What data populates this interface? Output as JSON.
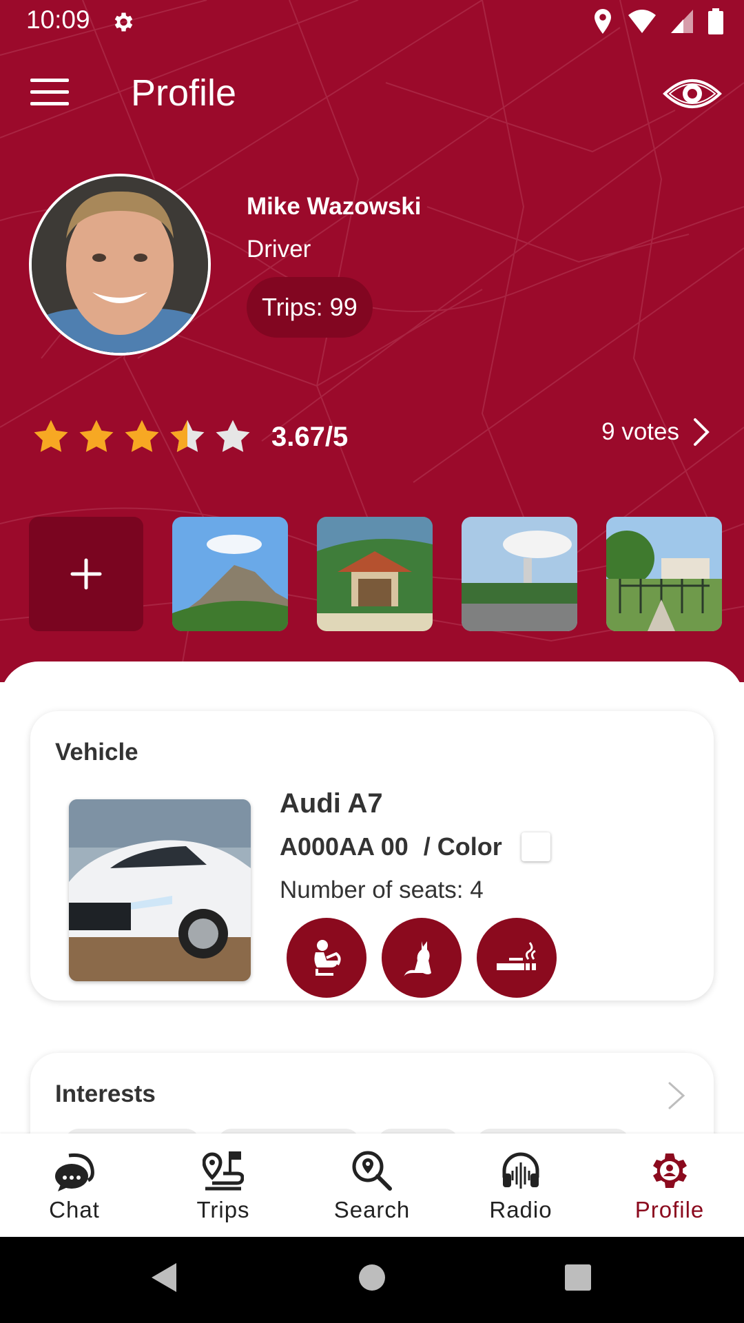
{
  "status_bar": {
    "time": "10:09",
    "icons": [
      "settings-icon",
      "location-icon",
      "wifi-icon",
      "signal-icon",
      "battery-icon"
    ]
  },
  "appbar": {
    "title": "Profile"
  },
  "profile": {
    "name": "Mike Wazowski",
    "role": "Driver",
    "trips": "Trips: 99"
  },
  "rating": {
    "value_text": "3.67/5",
    "value": 3.67,
    "max": 5,
    "votes": "9 votes"
  },
  "photos": [
    "mountain-photo",
    "gazebo-photo",
    "monument-photo",
    "park-gate-photo"
  ],
  "vehicle": {
    "title": "Vehicle",
    "model": "Audi A7",
    "plate": "A000AA 00",
    "color_label": "/ Color",
    "color": "#ffffff",
    "seats": "Number of seats: 4",
    "features": [
      "child-seat-icon",
      "pets-icon",
      "smoking-icon"
    ]
  },
  "interests": {
    "title": "Interests"
  },
  "nav": {
    "items": [
      {
        "label": "Chat",
        "icon": "chat-icon"
      },
      {
        "label": "Trips",
        "icon": "trips-icon"
      },
      {
        "label": "Search",
        "icon": "search-icon"
      },
      {
        "label": "Radio",
        "icon": "radio-icon"
      },
      {
        "label": "Profile",
        "icon": "profile-gear-icon"
      }
    ],
    "active": "Profile"
  },
  "colors": {
    "brand": "#9b0a2b",
    "brand_dark": "#8b0a1e",
    "star": "#f7a823"
  }
}
